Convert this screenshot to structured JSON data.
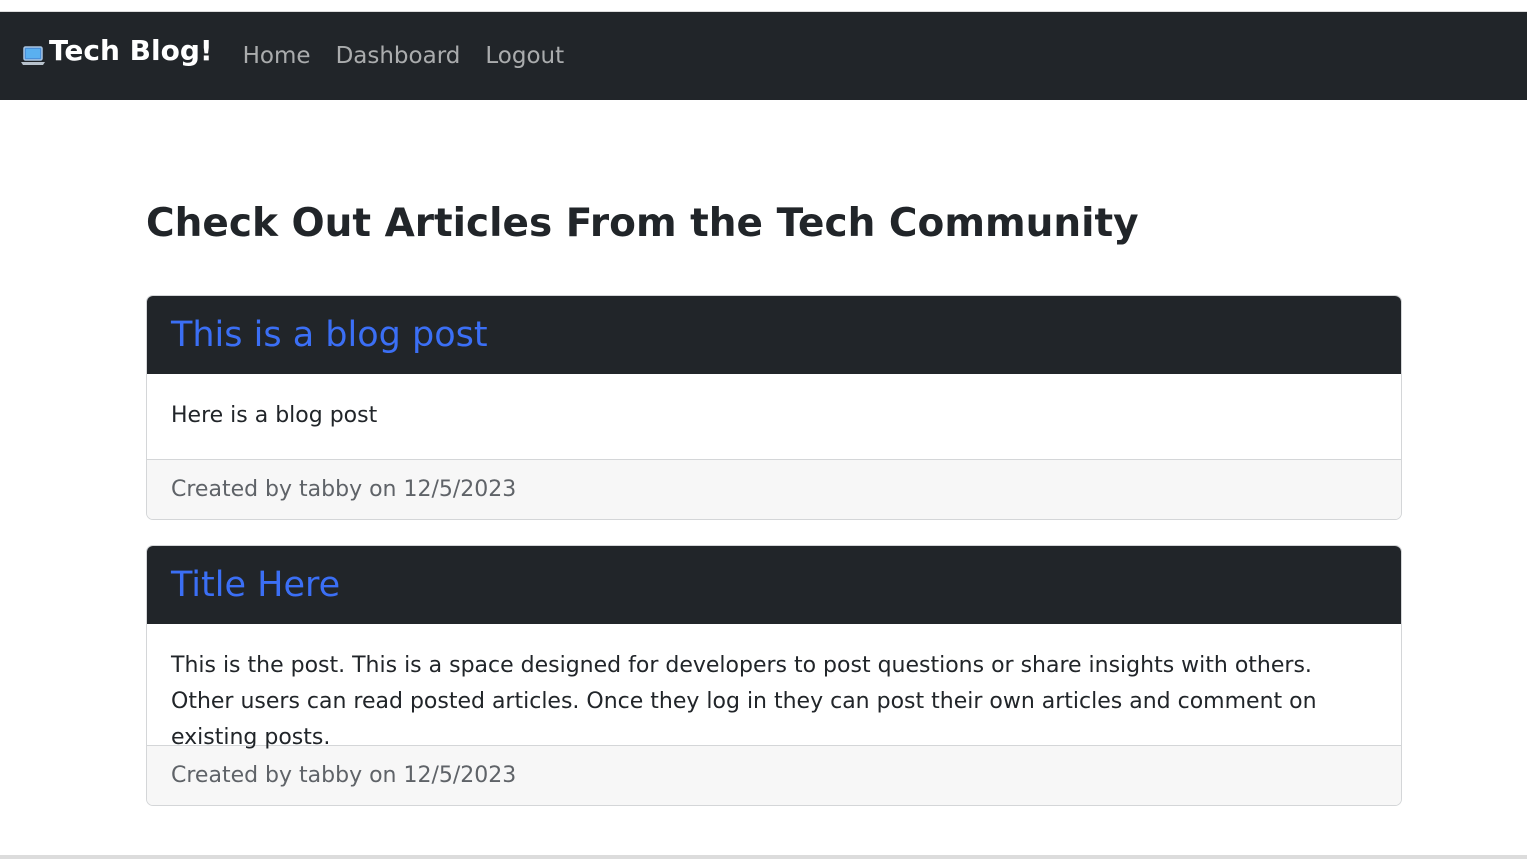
{
  "navbar": {
    "brand_icon": "laptop-icon",
    "brand_text": "Tech Blog!",
    "links": [
      {
        "label": "Home"
      },
      {
        "label": "Dashboard"
      },
      {
        "label": "Logout"
      }
    ]
  },
  "main": {
    "heading": "Check Out Articles From the Tech Community",
    "posts": [
      {
        "title": "This is a blog post",
        "body": "Here is a blog post",
        "footer": "Created by tabby on 12/5/2023"
      },
      {
        "title": "Title Here",
        "body": "This is the post. This is a space designed for developers to post questions or share insights with others. Other users can read posted articles. Once they log in they can post their own articles and comment on existing posts.",
        "footer": "Created by tabby on 12/5/2023"
      }
    ]
  },
  "colors": {
    "navbar_bg": "#212529",
    "link_title": "#3b6ff5",
    "footer_bg": "#f7f7f7"
  }
}
